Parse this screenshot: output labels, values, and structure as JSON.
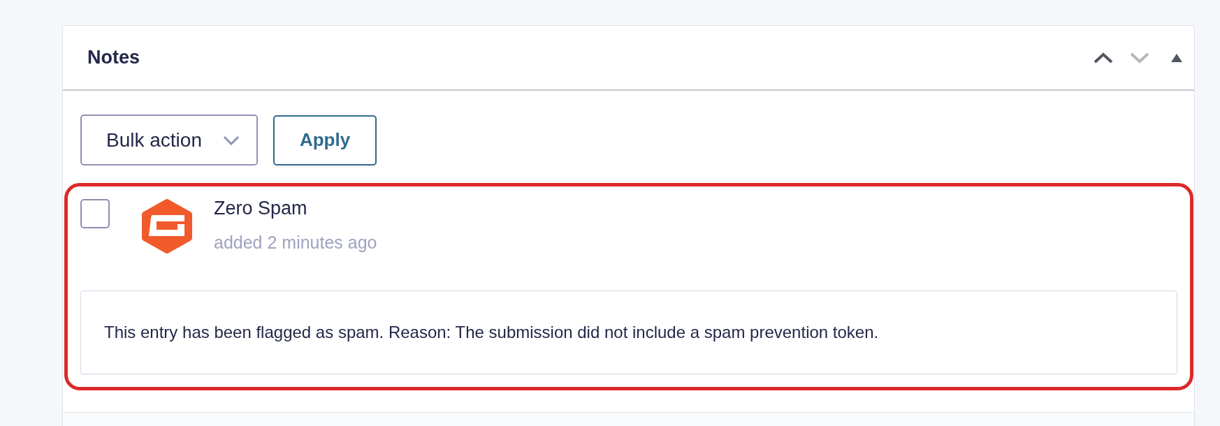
{
  "panel": {
    "title": "Notes",
    "header_buttons": [
      {
        "kind": "up",
        "disabled": false
      },
      {
        "kind": "down",
        "disabled": true
      },
      {
        "kind": "toggle",
        "expanded": true
      }
    ]
  },
  "toolbar": {
    "bulk_action": {
      "value": "Bulk action"
    },
    "apply_button": {
      "label": "Apply"
    }
  },
  "notes": [
    {
      "checked": false,
      "highlighted": true,
      "author": "Zero Spam",
      "meta": "added 2 minutes ago",
      "message": "This entry has been flagged as spam. Reason: The submission did not include a spam prevention token."
    }
  ]
}
